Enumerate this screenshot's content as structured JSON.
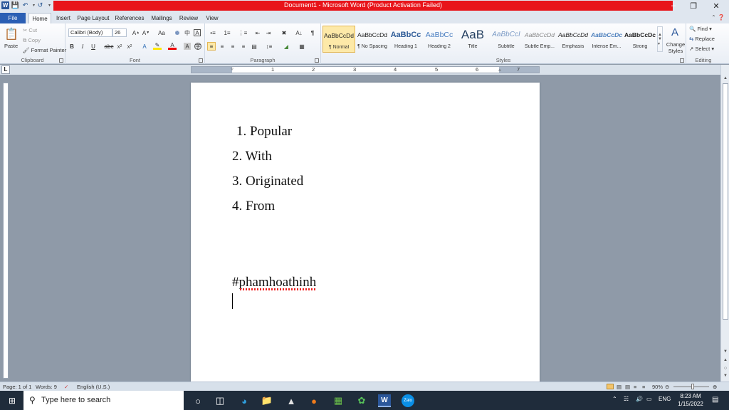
{
  "window": {
    "title": "Document1 - Microsoft Word (Product Activation Failed)",
    "accent": "#e8141a"
  },
  "quick_access": [
    "word-logo",
    "save-icon",
    "undo-icon",
    "redo-icon",
    "customize-icon"
  ],
  "tabs": [
    "File",
    "Home",
    "Insert",
    "Page Layout",
    "References",
    "Mailings",
    "Review",
    "View"
  ],
  "ribbon": {
    "clipboard": {
      "label": "Clipboard",
      "paste": "Paste",
      "cut": "Cut",
      "copy": "Copy",
      "format_painter": "Format Painter"
    },
    "font": {
      "label": "Font",
      "name": "Calibri (Body)",
      "size": "26"
    },
    "paragraph": {
      "label": "Paragraph"
    },
    "styles": {
      "label": "Styles",
      "items": [
        {
          "sample": "AaBbCcDd",
          "name": "¶ Normal"
        },
        {
          "sample": "AaBbCcDd",
          "name": "¶ No Spacing"
        },
        {
          "sample": "AaBbCc",
          "name": "Heading 1"
        },
        {
          "sample": "AaBbCc",
          "name": "Heading 2"
        },
        {
          "sample": "AaB",
          "name": "Title"
        },
        {
          "sample": "AaBbCcI",
          "name": "Subtitle"
        },
        {
          "sample": "AaBbCcDd",
          "name": "Subtle Emp..."
        },
        {
          "sample": "AaBbCcDd",
          "name": "Emphasis"
        },
        {
          "sample": "AaBbCcDc",
          "name": "Intense Em..."
        },
        {
          "sample": "AaBbCcDc",
          "name": "Strong"
        }
      ],
      "change_styles": "Change Styles"
    },
    "editing": {
      "label": "Editing",
      "find": "Find",
      "replace": "Replace",
      "select": "Select"
    }
  },
  "ruler": {
    "numbers": [
      "1",
      "2",
      "3",
      "4",
      "5",
      "6",
      "7"
    ],
    "tab_selector": "L"
  },
  "document": {
    "list": [
      {
        "num": "1.",
        "text": "Popular"
      },
      {
        "num": "2.",
        "text": "With"
      },
      {
        "num": "3.",
        "text": "Originated"
      },
      {
        "num": "4.",
        "text": "From"
      }
    ],
    "hashtag": "#phamhoathinh"
  },
  "status": {
    "page": "Page: 1 of 1",
    "words": "Words: 9",
    "language": "English (U.S.)",
    "zoom": "90%"
  },
  "taskbar": {
    "search_placeholder": "Type here to search",
    "language": "ENG",
    "time": "8:23 AM",
    "date": "1/15/2022"
  }
}
